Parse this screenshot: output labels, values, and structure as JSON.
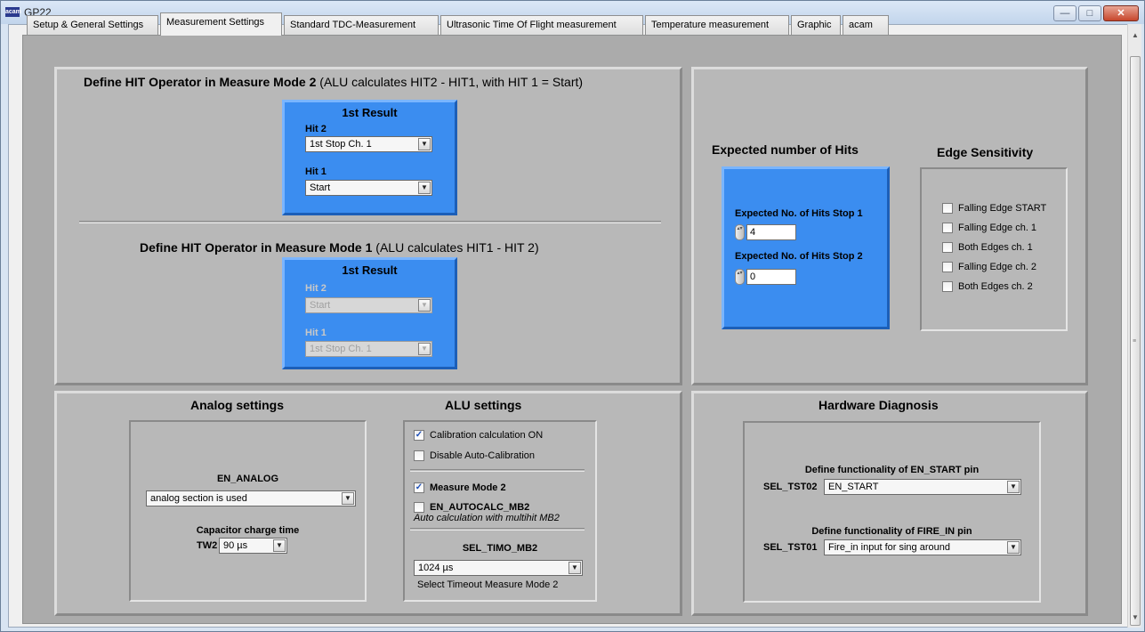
{
  "window": {
    "title": "GP22",
    "app_icon_text": "acam",
    "minimize_glyph": "—",
    "maximize_glyph": "□",
    "close_glyph": "✕"
  },
  "tabs": [
    {
      "label": "Setup & General Settings"
    },
    {
      "label": "Measurement Settings"
    },
    {
      "label": "Standard TDC-Measurement"
    },
    {
      "label": "Ultrasonic Time Of Flight measurement"
    },
    {
      "label": "Temperature measurement"
    },
    {
      "label": "Graphic"
    },
    {
      "label": "acam"
    }
  ],
  "mode2": {
    "heading_bold": "Define HIT Operator in Measure Mode 2",
    "heading_normal": "(ALU calculates HIT2 - HIT1, with HIT 1 = Start)",
    "result_label": "1st Result",
    "hit2_label": "Hit 2",
    "hit2_value": "1st Stop Ch. 1",
    "hit1_label": "Hit 1",
    "hit1_value": "Start"
  },
  "mode1": {
    "heading_bold": "Define HIT Operator in Measure Mode 1",
    "heading_normal": "(ALU calculates HIT1 - HIT 2)",
    "result_label": "1st Result",
    "hit2_label": "Hit 2",
    "hit2_value": "Start",
    "hit1_label": "Hit 1",
    "hit1_value": "1st Stop Ch. 1"
  },
  "expected_hits": {
    "heading": "Expected number of Hits",
    "stop1_label": "Expected No. of Hits Stop 1",
    "stop1_value": "4",
    "stop2_label": "Expected No. of Hits Stop 2",
    "stop2_value": "0"
  },
  "edge": {
    "heading": "Edge Sensitivity",
    "items": [
      {
        "label": "Falling Edge START"
      },
      {
        "label": "Falling Edge ch. 1"
      },
      {
        "label": "Both Edges ch. 1"
      },
      {
        "label": "Falling Edge  ch. 2"
      },
      {
        "label": "Both Edges ch. 2"
      }
    ]
  },
  "analog": {
    "heading": "Analog settings",
    "en_analog_label": "EN_ANALOG",
    "en_analog_value": "analog section is used",
    "charge_label": "Capacitor charge time",
    "tw2_label": "TW2",
    "tw2_value": "90 µs"
  },
  "alu": {
    "heading": "ALU settings",
    "calib_label": "Calibration calculation ON",
    "calib_checked": true,
    "disable_auto_label": "Disable Auto-Calibration",
    "disable_auto_checked": false,
    "mm2_label": "Measure Mode 2",
    "mm2_checked": true,
    "autocalc_label": "EN_AUTOCALC_MB2",
    "autocalc_checked": false,
    "autocalc_desc": "Auto calculation with multihit MB2",
    "timo_label": "SEL_TIMO_MB2",
    "timo_value": "1024 µs",
    "timo_desc": "Select Timeout Measure Mode 2"
  },
  "diag": {
    "heading": "Hardware Diagnosis",
    "en_start_title": "Define functionality of EN_START pin",
    "tst02_label": "SEL_TST02",
    "tst02_value": "EN_START",
    "fire_in_title": "Define functionality of FIRE_IN pin",
    "tst01_label": "SEL_TST01",
    "tst01_value": "Fire_in input for sing around"
  },
  "glyphs": {
    "checkmark": "✓",
    "dropdown": "▼",
    "scroll_up": "▲",
    "scroll_down": "▼",
    "spin": "▴▾",
    "grip": "≡"
  }
}
